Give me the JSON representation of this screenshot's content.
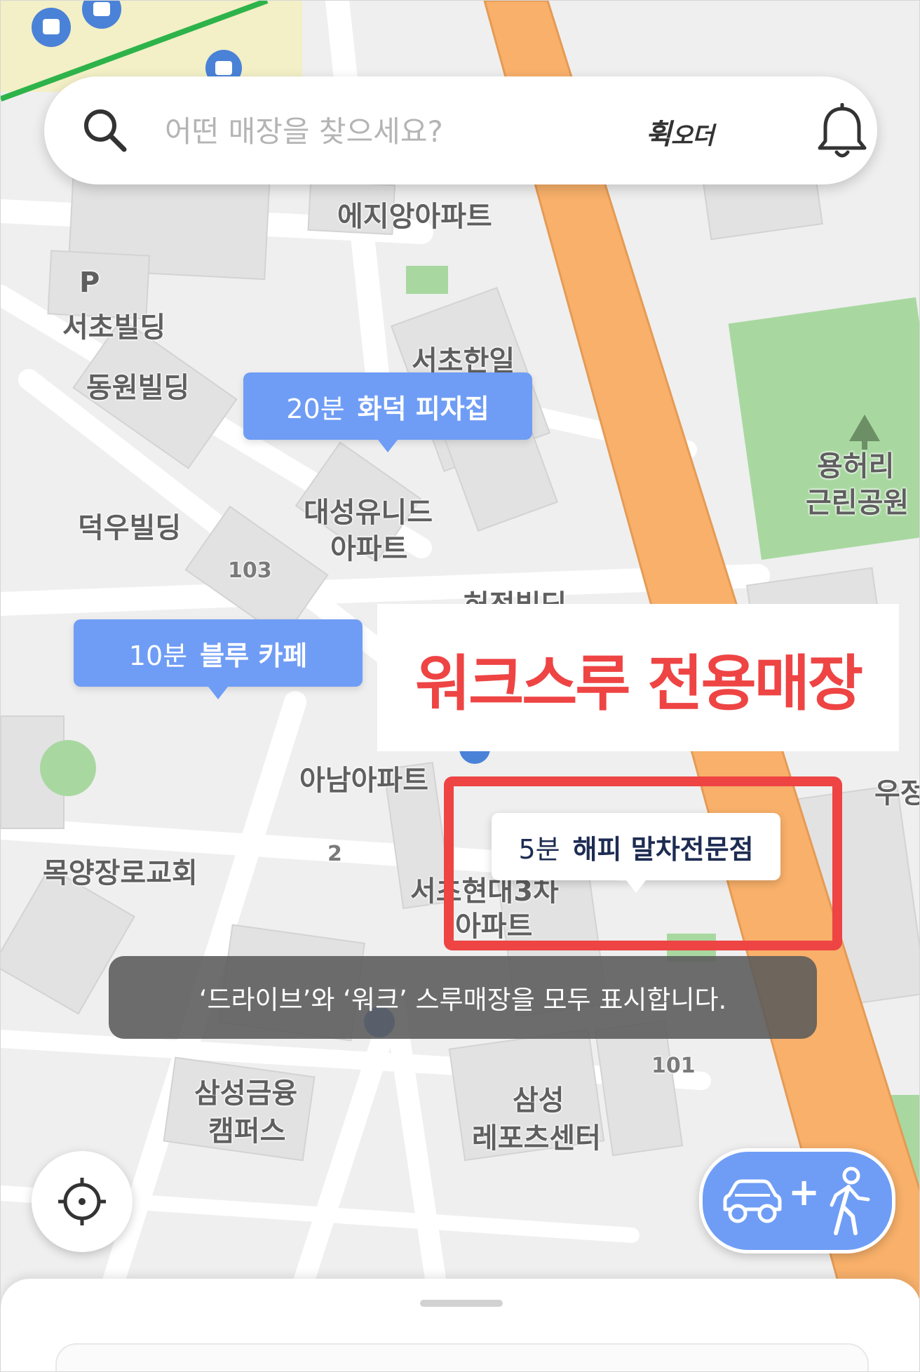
{
  "search": {
    "placeholder": "어떤 매장을 찾으세요?",
    "logo_main": "휙",
    "logo_sub": "오더"
  },
  "map": {
    "labels": {
      "ezi_apt": "에지앙아파트",
      "parking": "P",
      "seocho_bldg": "서초빌딩",
      "dongwon_bldg": "동원빌딩",
      "seocho_hanil": "서초한일",
      "deokwoo_bldg": "덕우빌딩",
      "daesung_line1": "대성유니드",
      "daesung_line2": "아파트",
      "num_103": "103",
      "anam_apt": "아남아파트",
      "num_2": "2",
      "church": "목양장로교회",
      "hyundai_line1": "서초현대3차",
      "hyundai_line2": "아파트",
      "samsung_fin_line1": "삼성금융",
      "samsung_fin_line2": "캠퍼스",
      "samsung_rep_line1": "삼성",
      "samsung_rep_line2": "레포츠센터",
      "num_101": "101",
      "park_line1": "용허리",
      "park_line2": "근린공원",
      "post": "우정",
      "heo_bldg": "허정빌딩"
    }
  },
  "stores": [
    {
      "time": "20분",
      "name": "화덕 피자집"
    },
    {
      "time": "10분",
      "name": "블루 카페"
    },
    {
      "time": "5분",
      "name": "해피 말차전문점"
    }
  ],
  "promo": {
    "text": "워크스루 전용매장"
  },
  "toast": {
    "text": "‘드라이브’와 ‘워크’ 스루매장을 모두 표시합니다."
  },
  "mode_button": {
    "plus": "+"
  },
  "icons": {
    "search": "search-icon",
    "bell": "bell-icon",
    "locate": "crosshair-icon",
    "car": "car-icon",
    "walk": "walking-person-icon"
  },
  "colors": {
    "pin_blue": "#6f9df5",
    "promo_red": "#ee4444",
    "road_orange": "#f8b06a"
  }
}
